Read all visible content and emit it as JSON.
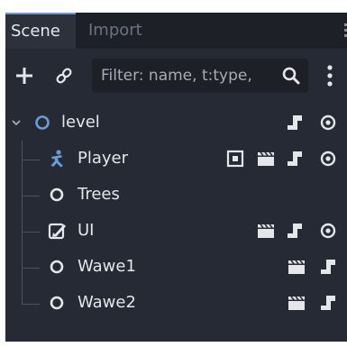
{
  "tabs": [
    {
      "label": "Scene",
      "active": true
    },
    {
      "label": "Import",
      "active": false
    }
  ],
  "toolbar": {
    "add_icon": "plus-icon",
    "link_icon": "link-icon",
    "filter_placeholder": "Filter: name, t:type,",
    "filter_value": "",
    "search_icon": "search-icon",
    "menu_icon": "kebab-menu-icon"
  },
  "tree": {
    "root": {
      "label": "level",
      "type_icon": "node3d-circle-icon",
      "expanded": true,
      "badges": [
        "script-icon",
        "visibility-eye-icon"
      ]
    },
    "children": [
      {
        "label": "Player",
        "type_icon": "character-body-icon",
        "badges": [
          "instance-icon",
          "clapperboard-icon",
          "script-icon",
          "visibility-eye-icon"
        ]
      },
      {
        "label": "Trees",
        "type_icon": "node-circle-icon",
        "badges": []
      },
      {
        "label": "UI",
        "type_icon": "control-icon",
        "badges": [
          "clapperboard-icon",
          "script-icon",
          "visibility-eye-icon"
        ]
      },
      {
        "label": "Wawe1",
        "type_icon": "node-circle-icon",
        "badges": [
          "clapperboard-icon",
          "script-icon"
        ]
      },
      {
        "label": "Wawe2",
        "type_icon": "node-circle-icon",
        "badges": [
          "clapperboard-icon",
          "script-icon"
        ]
      }
    ]
  },
  "colors": {
    "panel_bg": "#252a34",
    "tab_bar_bg": "#1d2027",
    "active_tab_accent": "#6b9bd2",
    "text": "#e4e6ea",
    "node_blue": "#6b9bd2",
    "icon_white": "#e4e6ea"
  }
}
